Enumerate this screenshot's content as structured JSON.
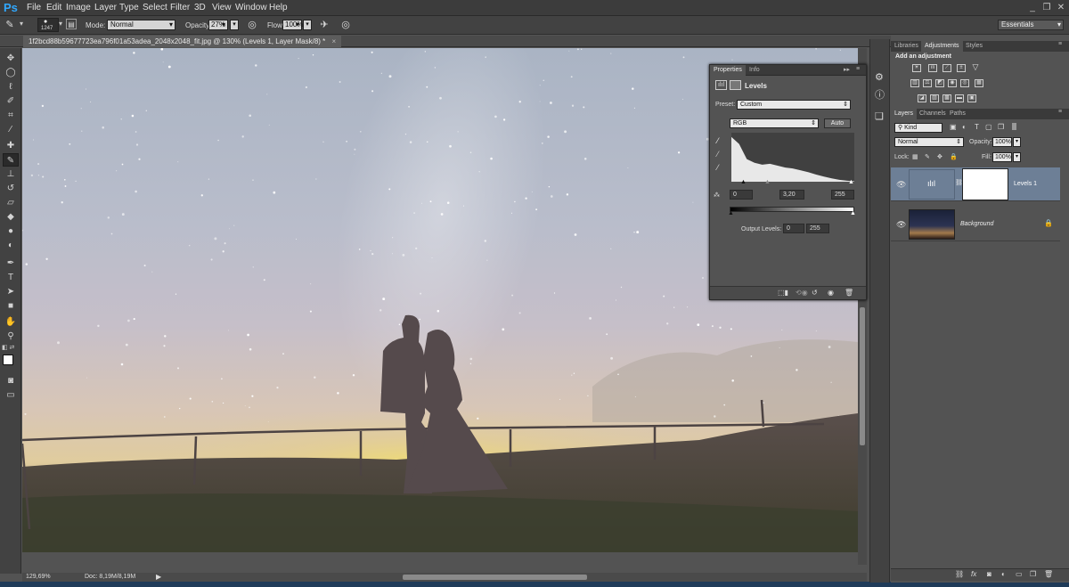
{
  "app": {
    "logo": "Ps"
  },
  "menu": [
    "File",
    "Edit",
    "Image",
    "Layer",
    "Type",
    "Select",
    "Filter",
    "3D",
    "View",
    "Window",
    "Help"
  ],
  "options": {
    "brush_size": "1247",
    "mode_label": "Mode:",
    "mode_value": "Normal",
    "opacity_label": "Opacity:",
    "opacity_value": "27%",
    "flow_label": "Flow:",
    "flow_value": "100%",
    "workspace": "Essentials"
  },
  "document": {
    "tab_title": "1f2bcd88b59677723ea796f01a53adea_2048x2048_fit.jpg @ 130% (Levels 1, Layer Mask/8) *"
  },
  "status": {
    "zoom": "129,69%",
    "doc_info": "Doc: 8,19M/8,19M"
  },
  "properties": {
    "tabs": [
      "Properties",
      "Info"
    ],
    "title": "Levels",
    "preset_label": "Preset:",
    "preset_value": "Custom",
    "channel": "RGB",
    "auto_label": "Auto",
    "input_black": "0",
    "input_gamma": "3,20",
    "input_white": "255",
    "output_label": "Output Levels:",
    "output_black": "0",
    "output_white": "255"
  },
  "right_panel": {
    "top_tabs": [
      "Libraries",
      "Adjustments",
      "Styles"
    ],
    "add_adjustment": "Add an adjustment",
    "layer_tabs": [
      "Layers",
      "Channels",
      "Paths"
    ],
    "kind_label": "Kind",
    "blend_mode": "Normal",
    "opacity_label": "Opacity:",
    "opacity_value": "100%",
    "lock_label": "Lock:",
    "fill_label": "Fill:",
    "fill_value": "100%",
    "layers": [
      {
        "name": "Levels 1",
        "selected": true
      },
      {
        "name": "Background",
        "selected": false
      }
    ]
  },
  "colors": {
    "accent": "#31a8ff",
    "selected_layer": "#6d7f96"
  },
  "chart_data": {
    "type": "area",
    "title": "",
    "xlabel": "",
    "ylabel": "",
    "x": [
      0,
      16,
      32,
      48,
      64,
      80,
      96,
      112,
      128,
      144,
      160,
      176,
      192,
      208,
      224,
      240,
      255
    ],
    "values": [
      95,
      80,
      48,
      40,
      36,
      38,
      34,
      30,
      28,
      24,
      20,
      15,
      11,
      7,
      4,
      2,
      1
    ],
    "ylim": [
      0,
      100
    ]
  }
}
